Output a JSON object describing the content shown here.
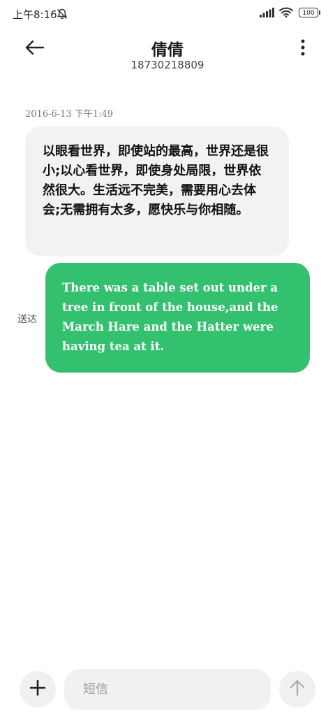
{
  "status_bar": {
    "time": "上午8:16",
    "mute_icon": "bell-off-icon",
    "signal_icon": "signal-bars-icon",
    "wifi_icon": "wifi-icon",
    "battery": "100"
  },
  "header": {
    "back_icon": "arrow-left-icon",
    "contact_name": "倩倩",
    "contact_number": "18730218809",
    "more_icon": "more-vertical-icon"
  },
  "conversation": {
    "timestamp": "2016-6-13 下午1:49",
    "incoming_message": "以眼看世界，即使站的最高，世界还是很小;以心看世界，即使身处局限，世界依然很大。生活远不完美，需要用心去体会;无需拥有太多，愿快乐与你相随。",
    "outgoing_status": "送达",
    "outgoing_message": "There was a table set out under a tree in front of the house,and the March Hare and the Hatter were having tea at it.",
    "incoming_bubble_color": "#f2f2f2",
    "outgoing_bubble_color": "#33c170"
  },
  "composer": {
    "add_icon": "plus-icon",
    "placeholder": "短信",
    "value": "",
    "send_icon": "arrow-up-icon"
  }
}
